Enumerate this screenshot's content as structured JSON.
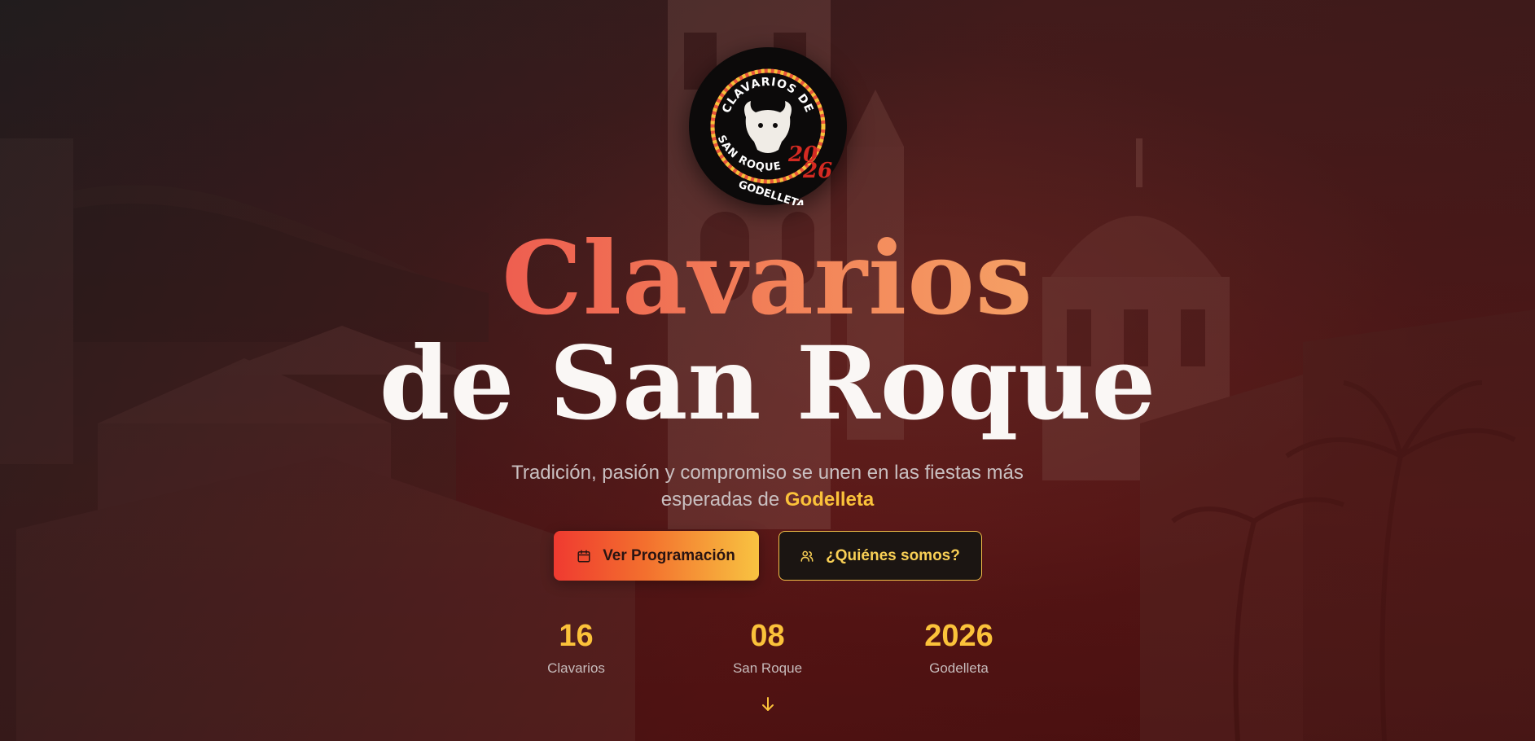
{
  "logo": {
    "line_top": "CLAVARIOS DE",
    "line_bottom_1": "SAN ROQUE",
    "line_bottom_2": "GODELLETA",
    "year_a": "20",
    "year_b": "26"
  },
  "hero": {
    "title_line1": "Clavarios",
    "title_line2": "de San Roque",
    "subtitle_text": "Tradición, pasión y compromiso se unen en las fiestas más esperadas de",
    "subtitle_highlight": "Godelleta"
  },
  "buttons": {
    "primary_label": "Ver Programación",
    "primary_icon": "calendar-icon",
    "secondary_label": "¿Quiénes somos?",
    "secondary_icon": "users-icon"
  },
  "stats": [
    {
      "value": "16",
      "label": "Clavarios"
    },
    {
      "value": "08",
      "label": "San Roque"
    },
    {
      "value": "2026",
      "label": "Godelleta"
    }
  ],
  "scroll_icon": "arrow-down-icon",
  "colors": {
    "accent_gold": "#fbc23a",
    "accent_coral": "#f3865a",
    "accent_red": "#ef3a30",
    "background_dark": "#1a0f0f"
  }
}
